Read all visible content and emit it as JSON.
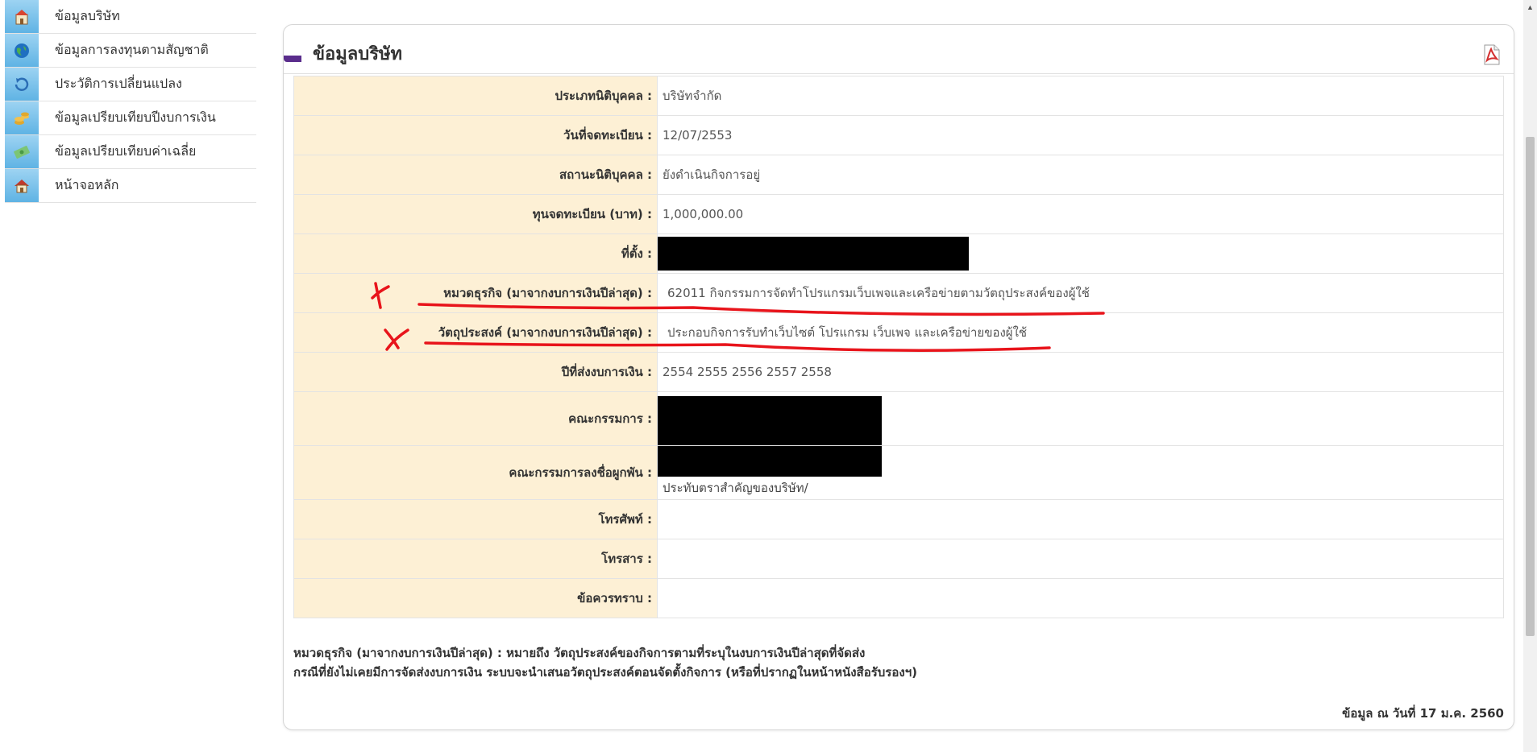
{
  "sidebar": {
    "items": [
      {
        "label": "ข้อมูลบริษัท",
        "icon": "building-icon"
      },
      {
        "label": "ข้อมูลการลงทุนตามสัญชาติ",
        "icon": "globe-icon"
      },
      {
        "label": "ประวัติการเปลี่ยนแปลง",
        "icon": "history-icon"
      },
      {
        "label": "ข้อมูลเปรียบเทียบปีงบการเงิน",
        "icon": "coins-icon"
      },
      {
        "label": "ข้อมูลเปรียบเทียบค่าเฉลี่ย",
        "icon": "money-icon"
      },
      {
        "label": "หน้าจอหลัก",
        "icon": "home-icon"
      }
    ]
  },
  "panel": {
    "title": "ข้อมูลบริษัท",
    "rows": [
      {
        "label": "ประเภทนิติบุคคล :",
        "value": "บริษัทจำกัด"
      },
      {
        "label": "วันที่จดทะเบียน :",
        "value": "12/07/2553"
      },
      {
        "label": "สถานะนิติบุคคล :",
        "value": "ยังดำเนินกิจการอยู่"
      },
      {
        "label": "ทุนจดทะเบียน (บาท) :",
        "value": "1,000,000.00"
      },
      {
        "label": "ที่ตั้ง :",
        "value": ""
      },
      {
        "label": "หมวดธุรกิจ (มาจากงบการเงินปีล่าสุด) :",
        "value": "62011 กิจกรรมการจัดทำโปรแกรมเว็บเพจและเครือข่ายตามวัตถุประสงค์ของผู้ใช้"
      },
      {
        "label": "วัตถุประสงค์ (มาจากงบการเงินปีล่าสุด) :",
        "value": "ประกอบกิจการรับทำเว็บไซต์ โปรแกรม เว็บเพจ และเครือข่ายของผู้ใช้"
      },
      {
        "label": "ปีที่ส่งงบการเงิน :",
        "value": "2554 2555 2556 2557 2558"
      },
      {
        "label": "คณะกรรมการ :",
        "value": ""
      },
      {
        "label": "คณะกรรมการลงชื่อผูกพัน :",
        "value": "ประทับตราสำคัญของบริษัท/"
      },
      {
        "label": "โทรศัพท์ :",
        "value": ""
      },
      {
        "label": "โทรสาร :",
        "value": ""
      },
      {
        "label": "ข้อควรทราบ :",
        "value": ""
      }
    ],
    "notes": [
      "หมวดธุรกิจ (มาจากงบการเงินปีล่าสุด) : หมายถึง วัตถุประสงค์ของกิจการตามที่ระบุในงบการเงินปีล่าสุดที่จัดส่ง",
      "กรณีที่ยังไม่เคยมีการจัดส่งงบการเงิน ระบบจะนำเสนอวัตถุประสงค์ตอนจัดตั้งกิจการ (หรือที่ปรากฏในหน้าหนังสือรับรองฯ)"
    ],
    "as_of": "ข้อมูล ณ วันที่ 17 ม.ค. 2560"
  },
  "colors": {
    "label_bg": "#fdf0d5",
    "accent": "#5a2d8c",
    "annotation": "#e8141b"
  }
}
